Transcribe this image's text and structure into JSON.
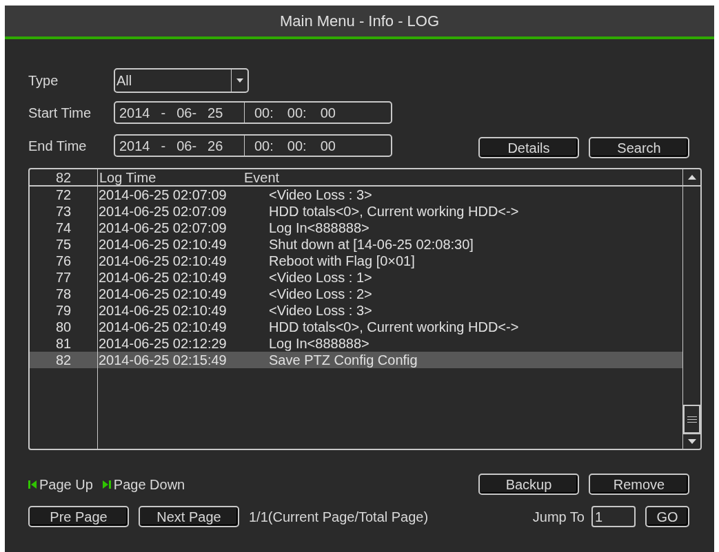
{
  "window": {
    "title": "Main Menu - Info - LOG"
  },
  "filters": {
    "type_label": "Type",
    "type_value": "All",
    "start_label": "Start Time",
    "start_date": [
      "2014",
      "-",
      "06-",
      "25"
    ],
    "start_time": [
      "00:",
      "00:",
      "00"
    ],
    "end_label": "End Time",
    "end_date": [
      "2014",
      "-",
      "06-",
      "26"
    ],
    "end_time": [
      "00:",
      "00:",
      "00"
    ]
  },
  "top_buttons": [
    "Details",
    "Search"
  ],
  "table": {
    "columns": [
      "82",
      "Log Time",
      "Event"
    ],
    "rows": [
      {
        "no": "72",
        "time": "2014-06-25 02:07:09",
        "event": "<Video Loss : 3>",
        "selected": false
      },
      {
        "no": "73",
        "time": "2014-06-25 02:07:09",
        "event": "HDD totals<0>, Current working HDD<->",
        "selected": false
      },
      {
        "no": "74",
        "time": "2014-06-25 02:07:09",
        "event": "Log In<888888>",
        "selected": false
      },
      {
        "no": "75",
        "time": "2014-06-25 02:10:49",
        "event": "Shut down at [14-06-25 02:08:30]",
        "selected": false
      },
      {
        "no": "76",
        "time": "2014-06-25 02:10:49",
        "event": "Reboot with Flag [0×01]",
        "selected": false
      },
      {
        "no": "77",
        "time": "2014-06-25 02:10:49",
        "event": "<Video Loss : 1>",
        "selected": false
      },
      {
        "no": "78",
        "time": "2014-06-25 02:10:49",
        "event": "<Video Loss : 2>",
        "selected": false
      },
      {
        "no": "79",
        "time": "2014-06-25 02:10:49",
        "event": "<Video Loss : 3>",
        "selected": false
      },
      {
        "no": "80",
        "time": "2014-06-25 02:10:49",
        "event": "HDD totals<0>, Current working HDD<->",
        "selected": false
      },
      {
        "no": "81",
        "time": "2014-06-25 02:12:29",
        "event": "Log In<888888>",
        "selected": false
      },
      {
        "no": "82",
        "time": "2014-06-25 02:15:49",
        "event": "Save PTZ Config Config",
        "selected": true
      }
    ]
  },
  "paging": {
    "page_up": "Page Up",
    "page_down": "Page Down",
    "buttons": [
      "Backup",
      "Remove"
    ],
    "pre_page": "Pre Page",
    "next_page": "Next Page",
    "page_info": "1/1(Current Page/Total Page)",
    "jump_label": "Jump To",
    "jump_value": "1",
    "go": "GO"
  }
}
